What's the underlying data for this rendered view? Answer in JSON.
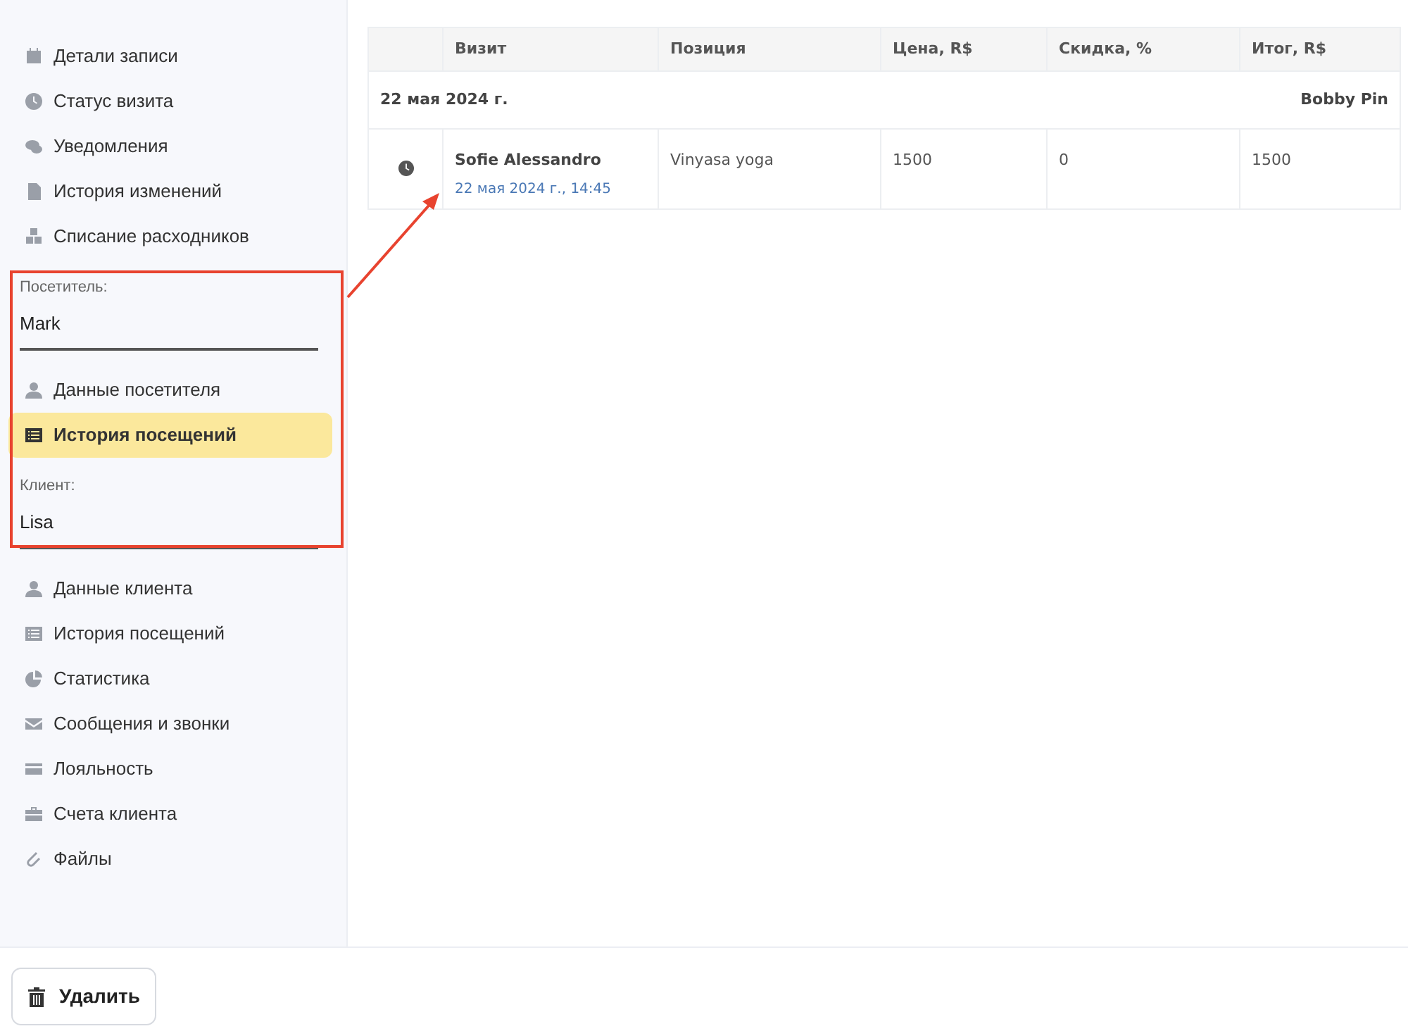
{
  "sidebar": {
    "sections": [
      {
        "items": [
          {
            "label": "Детали записи",
            "selected": false
          },
          {
            "label": "Статус визита",
            "selected": false
          },
          {
            "label": "Уведомления",
            "selected": false
          },
          {
            "label": "История изменений",
            "selected": false
          },
          {
            "label": "Списание расходников",
            "selected": false
          }
        ]
      },
      {
        "field_label": "Посетитель:",
        "field_value": "Mark",
        "items": [
          {
            "label": "Данные посетителя",
            "selected": false
          },
          {
            "label": "История посещений",
            "selected": true
          }
        ]
      },
      {
        "field_label": "Клиент:",
        "field_value": "Lisa",
        "items": [
          {
            "label": "Данные клиента",
            "selected": false
          },
          {
            "label": "История посещений",
            "selected": false
          },
          {
            "label": "Статистика",
            "selected": false
          },
          {
            "label": "Сообщения и звонки",
            "selected": false
          },
          {
            "label": "Лояльность",
            "selected": false
          },
          {
            "label": "Счета клиента",
            "selected": false
          },
          {
            "label": "Файлы",
            "selected": false
          }
        ]
      }
    ]
  },
  "table": {
    "columns": [
      "Визит",
      "Позиция",
      "Цена, R$",
      "Скидка, %",
      "Итог, R$"
    ],
    "groups": [
      {
        "date": "22 мая 2024 г.",
        "staff": "Bobby Pin",
        "rows": [
          {
            "visitor": "Sofie Alessandro",
            "datetime": "22 мая 2024 г., 14:45",
            "position": "Vinyasa yoga",
            "price": "1500",
            "discount": "0",
            "total": "1500"
          }
        ]
      }
    ]
  },
  "footer": {
    "delete_button": "Удалить"
  }
}
